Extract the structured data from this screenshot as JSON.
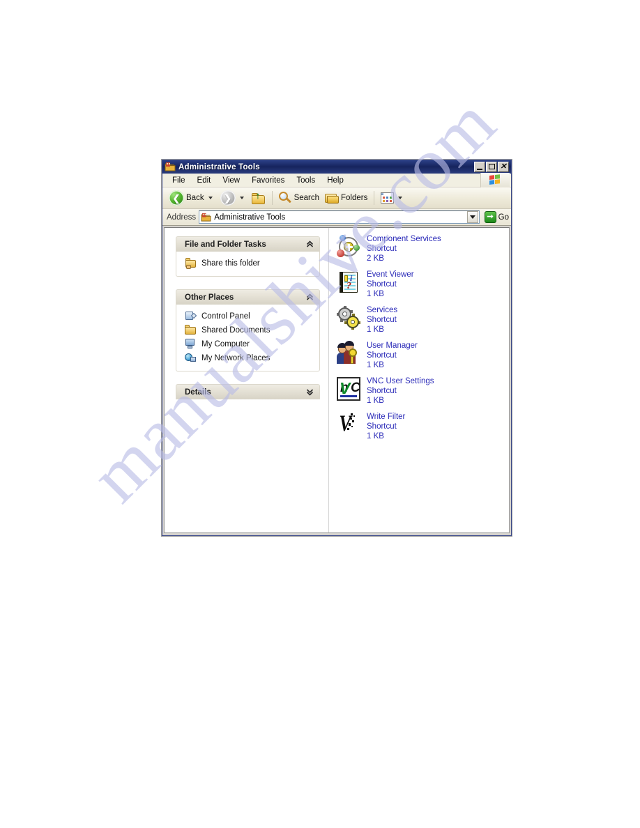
{
  "watermark": {
    "text": "manualshive.com"
  },
  "window": {
    "title": "Administrative Tools",
    "title_icon": "folder-admin-tools-icon",
    "controls": {
      "minimize": "_",
      "maximize": "□",
      "close": "X"
    }
  },
  "menu": {
    "items": [
      {
        "label": "File"
      },
      {
        "label": "Edit"
      },
      {
        "label": "View"
      },
      {
        "label": "Favorites"
      },
      {
        "label": "Tools"
      },
      {
        "label": "Help"
      }
    ],
    "brand_icon": "windows-flag-icon"
  },
  "toolbar": {
    "back_label": "Back",
    "back_icon": "back-arrow-icon",
    "forward_icon": "forward-arrow-icon",
    "up_icon": "up-folder-icon",
    "search_label": "Search",
    "search_icon": "magnifier-icon",
    "folders_label": "Folders",
    "folders_icon": "folders-icon",
    "views_icon": "views-icon"
  },
  "address": {
    "label": "Address",
    "value": "Administrative Tools",
    "placeholder": "Address",
    "icon": "folder-admin-tools-icon",
    "go_label": "Go",
    "go_icon": "go-arrow-icon",
    "dropdown_icon": "chevron-down-icon"
  },
  "sidebar": {
    "panels": [
      {
        "title": "File and Folder Tasks",
        "toggle_icon": "chevron-up-icon",
        "items": [
          {
            "label": "Share this folder",
            "icon": "share-folder-icon"
          }
        ]
      },
      {
        "title": "Other Places",
        "toggle_icon": "chevron-up-icon",
        "items": [
          {
            "label": "Control Panel",
            "icon": "control-panel-icon"
          },
          {
            "label": "Shared Documents",
            "icon": "folder-icon"
          },
          {
            "label": "My Computer",
            "icon": "my-computer-icon"
          },
          {
            "label": "My Network Places",
            "icon": "network-places-icon"
          }
        ]
      },
      {
        "title": "Details",
        "toggle_icon": "chevron-down-icon",
        "items": []
      }
    ]
  },
  "files": {
    "items": [
      {
        "name": "Component Services",
        "type": "Shortcut",
        "size": "2 KB",
        "icon": "component-services-icon"
      },
      {
        "name": "Event Viewer",
        "type": "Shortcut",
        "size": "1 KB",
        "icon": "event-viewer-icon"
      },
      {
        "name": "Services",
        "type": "Shortcut",
        "size": "1 KB",
        "icon": "services-gears-icon"
      },
      {
        "name": "User Manager",
        "type": "Shortcut",
        "size": "1 KB",
        "icon": "user-manager-icon"
      },
      {
        "name": "VNC User Settings",
        "type": "Shortcut",
        "size": "1 KB",
        "icon": "vnc-icon"
      },
      {
        "name": "Write Filter",
        "type": "Shortcut",
        "size": "1 KB",
        "icon": "write-filter-icon"
      }
    ]
  },
  "colors": {
    "titlebar": "#16245e",
    "link_text": "#2a2ab8",
    "watermark": "#b9bce6",
    "panel_header": "#e3dfd3"
  }
}
